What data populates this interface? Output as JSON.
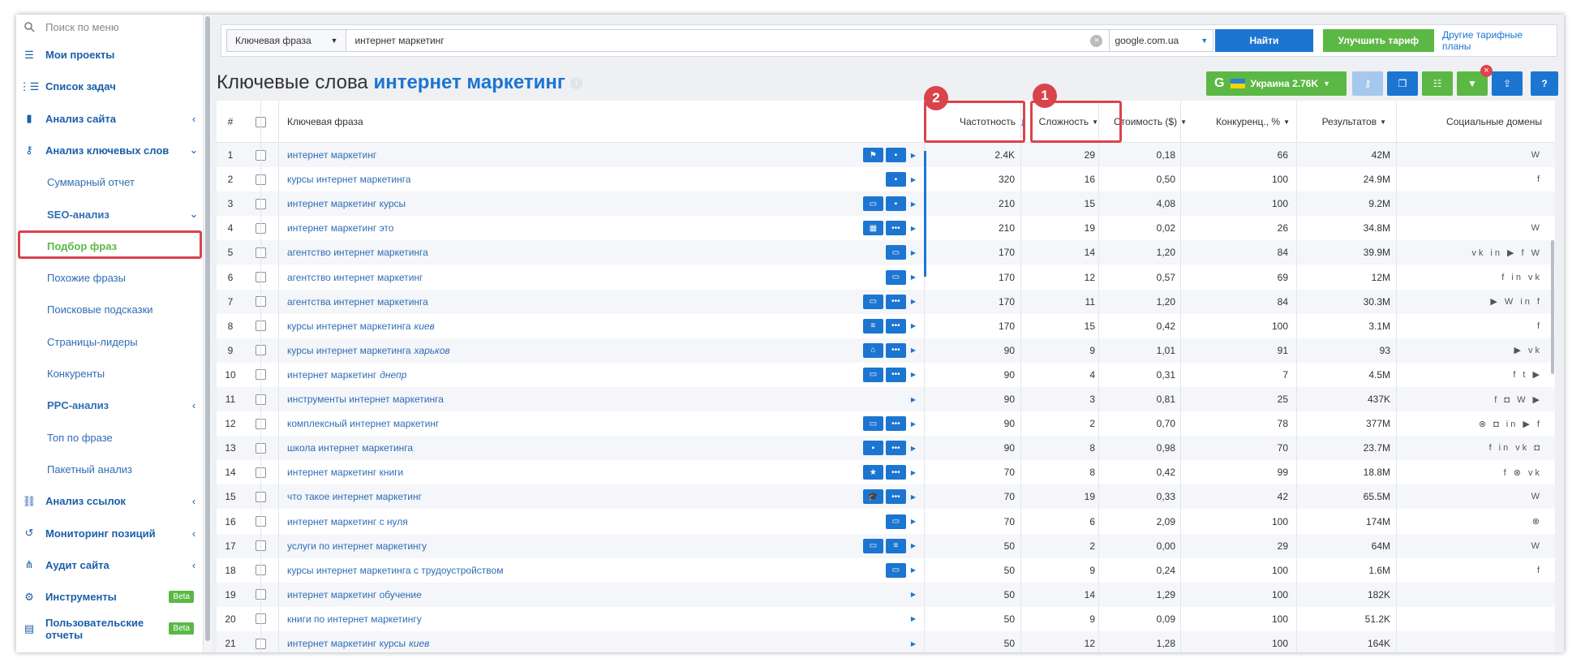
{
  "sidebar": {
    "search_placeholder": "Поиск по меню",
    "items": [
      {
        "label": "Мои проекты",
        "kind": "top",
        "icon": "list-icon"
      },
      {
        "label": "Список задач",
        "kind": "top",
        "icon": "checklist-icon"
      },
      {
        "label": "Анализ сайта",
        "kind": "top",
        "icon": "bar-chart-icon",
        "chevron": "‹"
      },
      {
        "label": "Анализ ключевых слов",
        "kind": "top",
        "icon": "key-icon",
        "chevron": "⌄"
      },
      {
        "label": "Суммарный отчет",
        "kind": "sub"
      },
      {
        "label": "SEO-анализ",
        "kind": "subhead",
        "chevron": "⌄"
      },
      {
        "label": "Подбор фраз",
        "kind": "sub",
        "active": true
      },
      {
        "label": "Похожие фразы",
        "kind": "sub"
      },
      {
        "label": "Поисковые подсказки",
        "kind": "sub"
      },
      {
        "label": "Страницы-лидеры",
        "kind": "sub"
      },
      {
        "label": "Конкуренты",
        "kind": "sub"
      },
      {
        "label": "PPC-анализ",
        "kind": "subhead",
        "chevron": "‹"
      },
      {
        "label": "Топ по фразе",
        "kind": "sub"
      },
      {
        "label": "Пакетный анализ",
        "kind": "sub"
      },
      {
        "label": "Анализ ссылок",
        "kind": "top",
        "icon": "link-icon",
        "chevron": "‹"
      },
      {
        "label": "Мониторинг позиций",
        "kind": "top",
        "icon": "history-icon",
        "chevron": "‹"
      },
      {
        "label": "Аудит сайта",
        "kind": "top",
        "icon": "sitemap-icon",
        "chevron": "‹"
      },
      {
        "label": "Инструменты",
        "kind": "top",
        "icon": "gear-icon",
        "badge": "Beta"
      },
      {
        "label": "Пользовательские отчеты",
        "kind": "top",
        "icon": "report-icon",
        "badge": "Beta"
      }
    ]
  },
  "search": {
    "mode": "Ключевая фраза",
    "query": "интернет маркетинг",
    "domain": "google.com.ua",
    "find": "Найти",
    "upgrade": "Улучшить тариф",
    "plans": "Другие тарифные планы"
  },
  "page": {
    "title": "Ключевые слова",
    "query": "интернет маркетинг",
    "region": "Украина 2.76K"
  },
  "colors": {
    "accent": "#1c75d1",
    "green": "#5cb845",
    "highlight": "#d9444b"
  },
  "table": {
    "headers": {
      "num": "#",
      "phrase": "Ключевая фраза",
      "freq": "Частотность",
      "difficulty": "Сложность",
      "cost": "Стоимость ($)",
      "competition": "Конкуренц., %",
      "results": "Результатов",
      "social": "Социальные домены"
    },
    "badges": {
      "freq": "2",
      "difficulty": "1"
    },
    "rows": [
      {
        "n": "1",
        "phrase": "интернет маркетинг",
        "city": "",
        "freq": "2.4K",
        "diff": "29",
        "cost": "0,18",
        "comp": "66",
        "res": "42M",
        "social": "W",
        "icons": [
          "flag-icon",
          "image-icon"
        ]
      },
      {
        "n": "2",
        "phrase": "курсы интернет маркетинга",
        "city": "",
        "freq": "320",
        "diff": "16",
        "cost": "0,50",
        "comp": "100",
        "res": "24.9M",
        "social": "f",
        "icons": [
          "image-icon"
        ]
      },
      {
        "n": "3",
        "phrase": "интернет маркетинг курсы",
        "city": "",
        "freq": "210",
        "diff": "15",
        "cost": "4,08",
        "comp": "100",
        "res": "9.2M",
        "social": "",
        "icons": [
          "comment-icon",
          "image-icon"
        ]
      },
      {
        "n": "4",
        "phrase": "интернет маркетинг это",
        "city": "",
        "freq": "210",
        "diff": "19",
        "cost": "0,02",
        "comp": "26",
        "res": "34.8M",
        "social": "W",
        "icons": [
          "knowledge-icon",
          "more-icon"
        ]
      },
      {
        "n": "5",
        "phrase": "агентство интернет маркетинга",
        "city": "",
        "freq": "170",
        "diff": "14",
        "cost": "1,20",
        "comp": "84",
        "res": "39.9M",
        "social": "vk in ▶ f W",
        "icons": [
          "comment-icon"
        ]
      },
      {
        "n": "6",
        "phrase": "агентство интернет маркетинг",
        "city": "",
        "freq": "170",
        "diff": "12",
        "cost": "0,57",
        "comp": "69",
        "res": "12M",
        "social": "f in vk",
        "icons": [
          "comment-icon"
        ]
      },
      {
        "n": "7",
        "phrase": "агентства интернет маркетинга",
        "city": "",
        "freq": "170",
        "diff": "11",
        "cost": "1,20",
        "comp": "84",
        "res": "30.3M",
        "social": "▶ W in f",
        "icons": [
          "comment-icon",
          "more-icon"
        ]
      },
      {
        "n": "8",
        "phrase": "курсы интернет маркетинга",
        "city": "киев",
        "freq": "170",
        "diff": "15",
        "cost": "0,42",
        "comp": "100",
        "res": "3.1M",
        "social": "f",
        "icons": [
          "list-icon",
          "more-icon"
        ]
      },
      {
        "n": "9",
        "phrase": "курсы интернет маркетинга",
        "city": "харьков",
        "freq": "90",
        "diff": "9",
        "cost": "1,01",
        "comp": "91",
        "res": "93",
        "social": "▶ vk",
        "icons": [
          "map-icon",
          "more-icon"
        ]
      },
      {
        "n": "10",
        "phrase": "интернет маркетинг",
        "city": "днепр",
        "freq": "90",
        "diff": "4",
        "cost": "0,31",
        "comp": "7",
        "res": "4.5M",
        "social": "f t ▶",
        "icons": [
          "comment-icon",
          "more-icon"
        ]
      },
      {
        "n": "11",
        "phrase": "инструменты интернет маркетинга",
        "city": "",
        "freq": "90",
        "diff": "3",
        "cost": "0,81",
        "comp": "25",
        "res": "437K",
        "social": "f ◘ W ▶",
        "icons": []
      },
      {
        "n": "12",
        "phrase": "комплексный интернет маркетинг",
        "city": "",
        "freq": "90",
        "diff": "2",
        "cost": "0,70",
        "comp": "78",
        "res": "377M",
        "social": "⊗ ◘ in ▶ f",
        "icons": [
          "comment-icon",
          "more-icon"
        ]
      },
      {
        "n": "13",
        "phrase": "школа интернет маркетинга",
        "city": "",
        "freq": "90",
        "diff": "8",
        "cost": "0,98",
        "comp": "70",
        "res": "23.7M",
        "social": "f in vk ◘",
        "icons": [
          "image-icon",
          "more-icon"
        ]
      },
      {
        "n": "14",
        "phrase": "интернет маркетинг книги",
        "city": "",
        "freq": "70",
        "diff": "8",
        "cost": "0,42",
        "comp": "99",
        "res": "18.8M",
        "social": "f ⊗ vk",
        "icons": [
          "star-icon",
          "more-icon"
        ]
      },
      {
        "n": "15",
        "phrase": "что такое интернет маркетинг",
        "city": "",
        "freq": "70",
        "diff": "19",
        "cost": "0,33",
        "comp": "42",
        "res": "65.5M",
        "social": "W",
        "icons": [
          "graduation-icon",
          "more-icon"
        ]
      },
      {
        "n": "16",
        "phrase": "интернет маркетинг с нуля",
        "city": "",
        "freq": "70",
        "diff": "6",
        "cost": "2,09",
        "comp": "100",
        "res": "174M",
        "social": "⊗",
        "icons": [
          "comment-icon"
        ]
      },
      {
        "n": "17",
        "phrase": "услуги по интернет маркетингу",
        "city": "",
        "freq": "50",
        "diff": "2",
        "cost": "0,00",
        "comp": "29",
        "res": "64M",
        "social": "W",
        "icons": [
          "comment-icon",
          "text-icon"
        ]
      },
      {
        "n": "18",
        "phrase": "курсы интернет маркетинга с трудоустройством",
        "city": "",
        "freq": "50",
        "diff": "9",
        "cost": "0,24",
        "comp": "100",
        "res": "1.6M",
        "social": "f",
        "icons": [
          "comment-icon"
        ]
      },
      {
        "n": "19",
        "phrase": "интернет маркетинг обучение",
        "city": "",
        "freq": "50",
        "diff": "14",
        "cost": "1,29",
        "comp": "100",
        "res": "182K",
        "social": "",
        "icons": []
      },
      {
        "n": "20",
        "phrase": "книги по интернет маркетингу",
        "city": "",
        "freq": "50",
        "diff": "9",
        "cost": "0,09",
        "comp": "100",
        "res": "51.2K",
        "social": "",
        "icons": []
      },
      {
        "n": "21",
        "phrase": "интернет маркетинг курсы",
        "city": "киев",
        "freq": "50",
        "diff": "12",
        "cost": "1,28",
        "comp": "100",
        "res": "164K",
        "social": "",
        "icons": []
      }
    ]
  }
}
